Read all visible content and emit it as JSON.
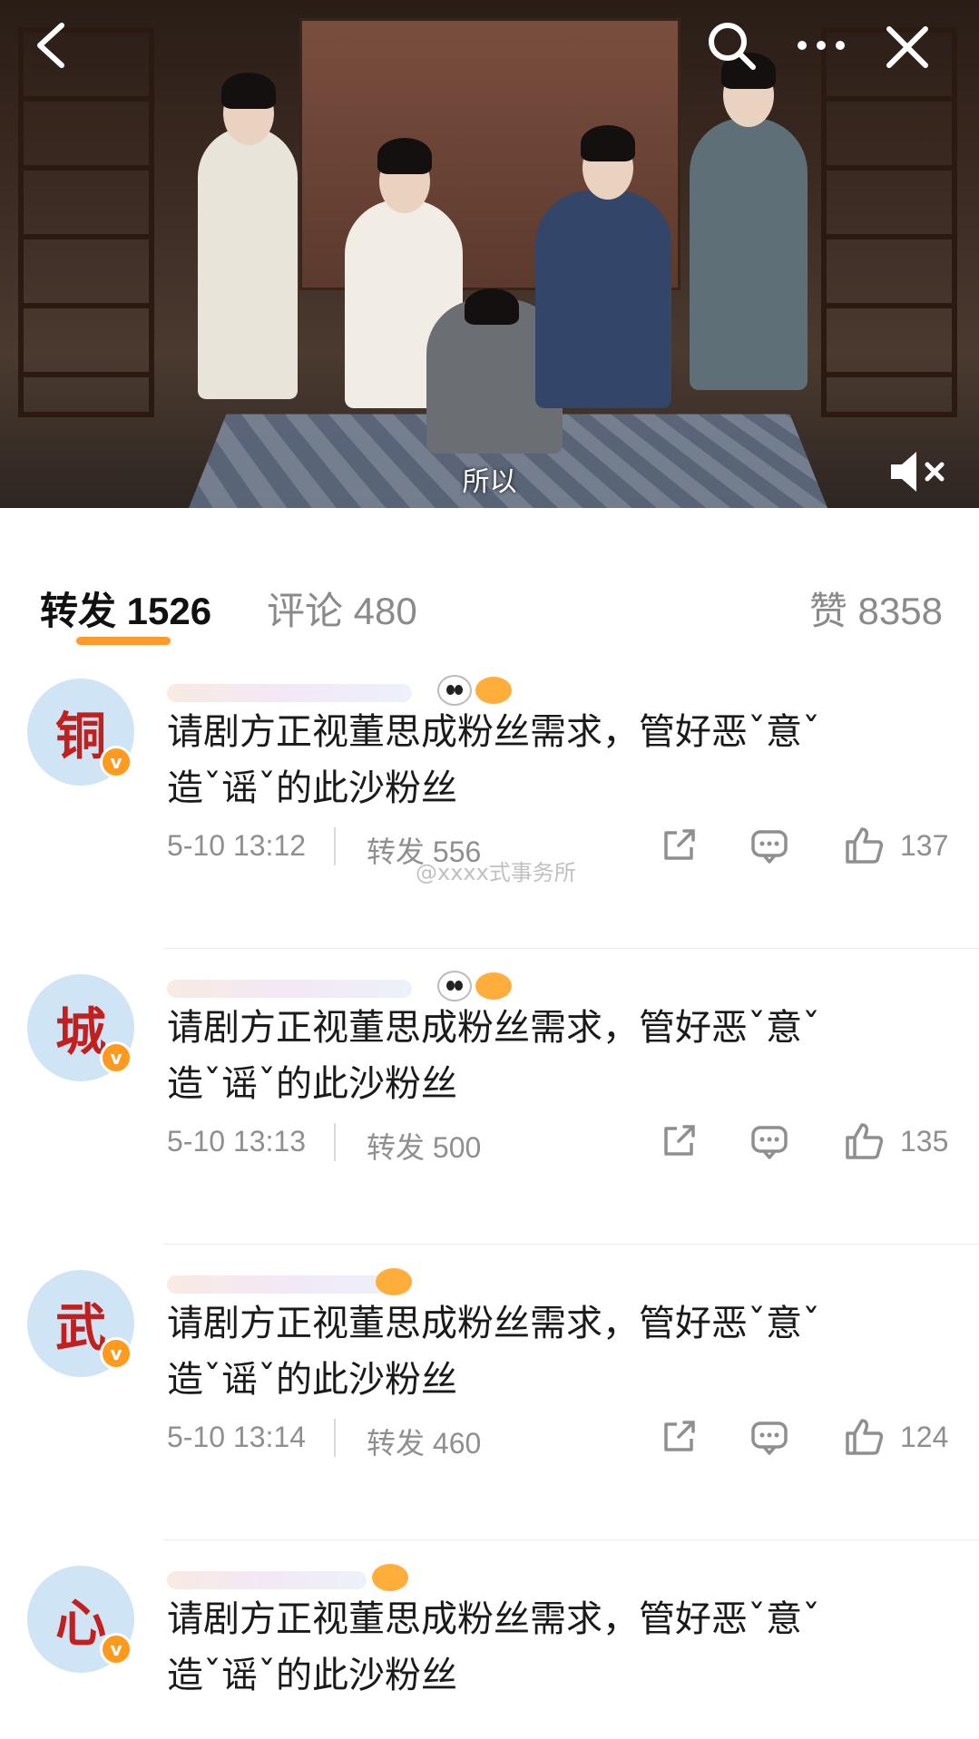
{
  "video": {
    "subtitle": "所以"
  },
  "tabs": {
    "repost": "转发 1526",
    "comment": "评论 480",
    "like": "赞 8358"
  },
  "watermark": "@xxxx式事务所",
  "reposts": [
    {
      "avatar_char": "铜",
      "text_line1": "请剧方正视董思成粉丝需求，管好恶ˇ意ˇ",
      "text_line2": "造ˇ谣ˇ的此沙粉丝",
      "time": "5-10 13:12",
      "repost_label": "转发 556",
      "like_count": "137"
    },
    {
      "avatar_char": "城",
      "text_line1": "请剧方正视董思成粉丝需求，管好恶ˇ意ˇ",
      "text_line2": "造ˇ谣ˇ的此沙粉丝",
      "time": "5-10 13:13",
      "repost_label": "转发 500",
      "like_count": "135"
    },
    {
      "avatar_char": "武",
      "text_line1": "请剧方正视董思成粉丝需求，管好恶ˇ意ˇ",
      "text_line2": "造ˇ谣ˇ的此沙粉丝",
      "time": "5-10 13:14",
      "repost_label": "转发 460",
      "like_count": "124"
    },
    {
      "avatar_char": "心",
      "text_line1": "请剧方正视董思成粉丝需求，管好恶ˇ意ˇ",
      "text_line2": "造ˇ谣ˇ的此沙粉丝"
    }
  ],
  "badge": "v"
}
